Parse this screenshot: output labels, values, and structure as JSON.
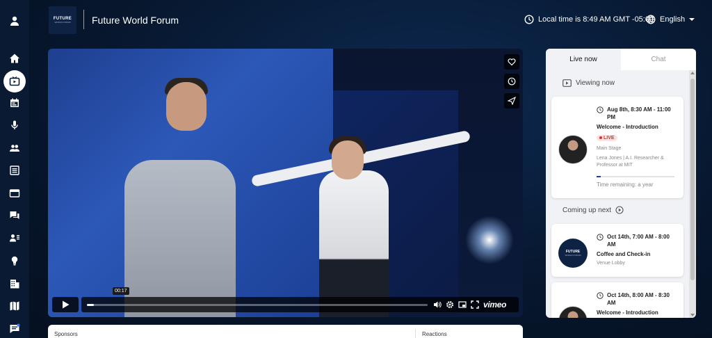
{
  "header": {
    "logo_line1": "FUTURE",
    "logo_line2": "WORLD FORUM",
    "title": "Future World Forum",
    "local_time": "Local time is 8:49 AM GMT -05:00",
    "language": "English"
  },
  "sidebar": {
    "items": [
      {
        "name": "profile",
        "icon": "user-icon"
      },
      {
        "name": "home",
        "icon": "home-icon"
      },
      {
        "name": "live",
        "icon": "tv-icon",
        "active": true
      },
      {
        "name": "agenda",
        "icon": "calendar-icon"
      },
      {
        "name": "speakers",
        "icon": "microphone-icon"
      },
      {
        "name": "attendees",
        "icon": "people-icon"
      },
      {
        "name": "documents",
        "icon": "list-icon"
      },
      {
        "name": "sessions",
        "icon": "window-icon"
      },
      {
        "name": "chat",
        "icon": "chat-bubbles-icon"
      },
      {
        "name": "networking",
        "icon": "contact-icon"
      },
      {
        "name": "ideas",
        "icon": "lightbulb-icon"
      },
      {
        "name": "exhibitors",
        "icon": "building-icon"
      },
      {
        "name": "map",
        "icon": "map-icon"
      },
      {
        "name": "messages",
        "icon": "message-icon"
      }
    ]
  },
  "video": {
    "current_time": "00:17",
    "progress": 0.02,
    "brand": "vimeo"
  },
  "bottom": {
    "sponsors": "Sponsors",
    "reactions": "Reactions"
  },
  "right_panel": {
    "tabs": [
      {
        "label": "Live now",
        "active": true
      },
      {
        "label": "Chat",
        "active": false
      }
    ],
    "viewing_now": "Viewing now",
    "coming_up_next": "Coming up next",
    "live_card": {
      "time": "Aug 8th, 8:30 AM - 11:00 PM",
      "title": "Welcome - Introduction",
      "badge": "LIVE",
      "location": "Main Stage",
      "speaker": "Lena Jones | A.I. Researcher & Professor at MIT",
      "progress": 0.05,
      "remaining": "Time remaining: a year"
    },
    "upcoming": [
      {
        "time": "Oct 14th, 7:00 AM - 8:00 AM",
        "title": "Coffee and Check-in",
        "location": "Venue Lobby",
        "avatar": "logo"
      },
      {
        "time": "Oct 14th, 8:00 AM - 8:30 AM",
        "title": "Welcome - Introduction",
        "avatar": "person"
      }
    ]
  },
  "colors": {
    "background": "#07172e",
    "sidebar": "#0a1a33",
    "live_red": "#e02b2b",
    "progress_blue": "#1f3fa3"
  }
}
